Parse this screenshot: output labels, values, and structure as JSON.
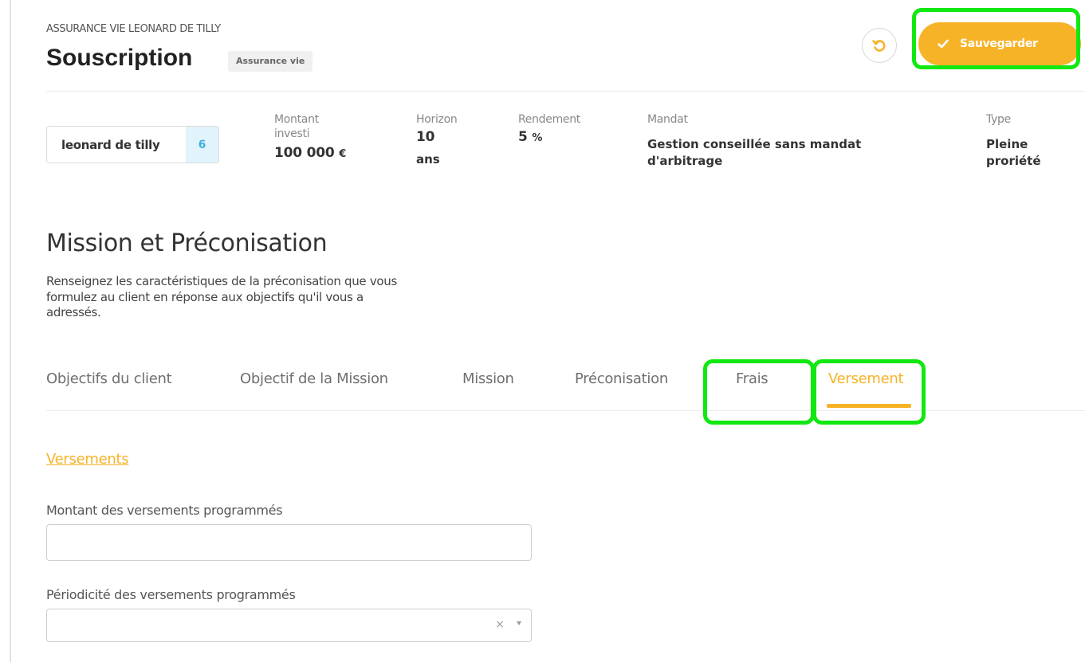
{
  "header": {
    "breadcrumb": "ASSURANCE VIE LEONARD DE TILLY",
    "title": "Souscription",
    "badge": "Assurance vie",
    "save_label": "Sauvegarder"
  },
  "summary": {
    "client_name": "leonard de tilly",
    "client_count": "6",
    "montant": {
      "label_1": "Montant",
      "label_2": "investi",
      "value": "100 000",
      "unit": "€"
    },
    "horizon": {
      "label": "Horizon",
      "value": "10",
      "unit": "ans"
    },
    "rendement": {
      "label": "Rendement",
      "value": "5",
      "unit": "%"
    },
    "mandat": {
      "label": "Mandat",
      "value_1": "Gestion conseillée sans mandat",
      "value_2": "d'arbitrage"
    },
    "type": {
      "label": "Type",
      "value_1": "Pleine",
      "value_2": "proriété"
    }
  },
  "section": {
    "title": "Mission et Préconisation",
    "desc_1": "Renseignez les caractéristiques de la préconisation que vous",
    "desc_2": "formulez au client en réponse aux objectifs qu'il vous a",
    "desc_3": "adressés."
  },
  "tabs": [
    {
      "label": "Objectifs du client"
    },
    {
      "label": "Objectif de la Mission"
    },
    {
      "label": "Mission"
    },
    {
      "label": "Préconisation"
    },
    {
      "label": "Frais"
    },
    {
      "label": "Versement",
      "active": true
    }
  ],
  "form": {
    "section_link": "Versements",
    "amount_label": "Montant des versements programmés",
    "amount_value": "",
    "period_label": "Périodicité des versements programmés",
    "period_value": "",
    "clear_glyph": "×"
  },
  "colors": {
    "accent": "#f6b327",
    "highlight": "#11e811",
    "badge_blue": "#3db0e0"
  }
}
